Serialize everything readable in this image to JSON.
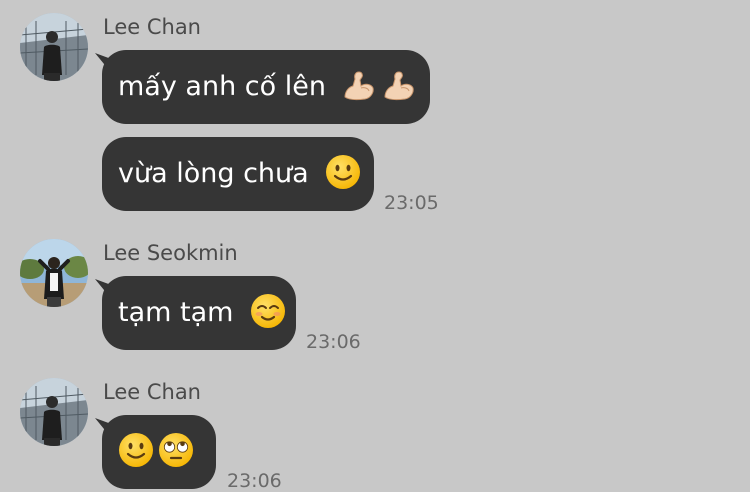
{
  "chat": {
    "groups": [
      {
        "sender": "Lee Chan",
        "avatar_icon": "profile-photo-lee-chan",
        "messages": [
          {
            "text": "mấy anh cố lên",
            "emojis": [
              "flexed-biceps-icon",
              "flexed-biceps-icon"
            ],
            "time": ""
          },
          {
            "text": "vừa lòng chưa",
            "emojis": [
              "slightly-smiling-face-icon"
            ],
            "time": "23:05"
          }
        ]
      },
      {
        "sender": "Lee Seokmin",
        "avatar_icon": "profile-photo-lee-seokmin",
        "messages": [
          {
            "text": "tạm tạm",
            "emojis": [
              "smiling-face-icon"
            ],
            "time": "23:06"
          }
        ]
      },
      {
        "sender": "Lee Chan",
        "avatar_icon": "profile-photo-lee-chan",
        "messages": [
          {
            "text": "",
            "emojis": [
              "slightly-smiling-face-icon",
              "face-with-rolling-eyes-icon"
            ],
            "time": "23:06"
          }
        ]
      }
    ]
  },
  "colors": {
    "background": "#c8c8c8",
    "bubble": "#353535",
    "bubble_text": "#ffffff",
    "sender_name": "#4a4a4a",
    "timestamp": "#6a6a6a",
    "emoji_yellow": "#ffcc33"
  }
}
